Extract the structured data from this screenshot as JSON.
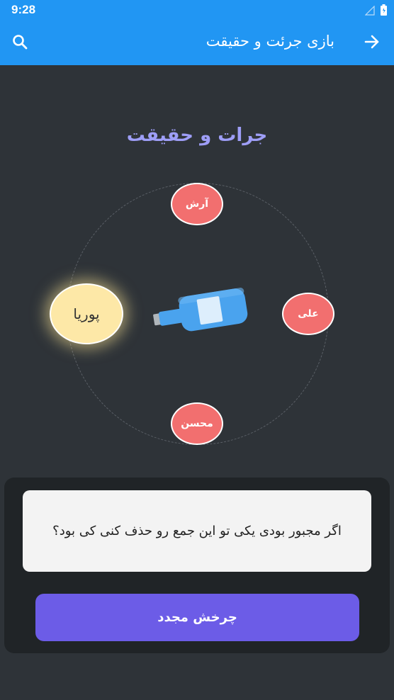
{
  "status_bar": {
    "time": "9:28"
  },
  "app_bar": {
    "title": "بازی جرئت و حقیقت",
    "back_icon": "arrow-forward-icon",
    "search_icon": "search-icon"
  },
  "game": {
    "title": "جرات و حقیقت",
    "players": [
      {
        "name": "آرش",
        "selected": false
      },
      {
        "name": "علی",
        "selected": false
      },
      {
        "name": "محسن",
        "selected": false
      },
      {
        "name": "پوریا",
        "selected": true
      }
    ]
  },
  "question": {
    "text": "اگر مجبور بودی یکی تو این جمع رو حذف کنی کی بود؟"
  },
  "actions": {
    "spin_again_label": "چرخش مجدد"
  },
  "colors": {
    "app_bar": "#2196f3",
    "background": "#2e3338",
    "player": "#f26f6f",
    "player_selected": "#fde8a7",
    "title": "#9e9ef7",
    "button": "#6c5ce7"
  }
}
